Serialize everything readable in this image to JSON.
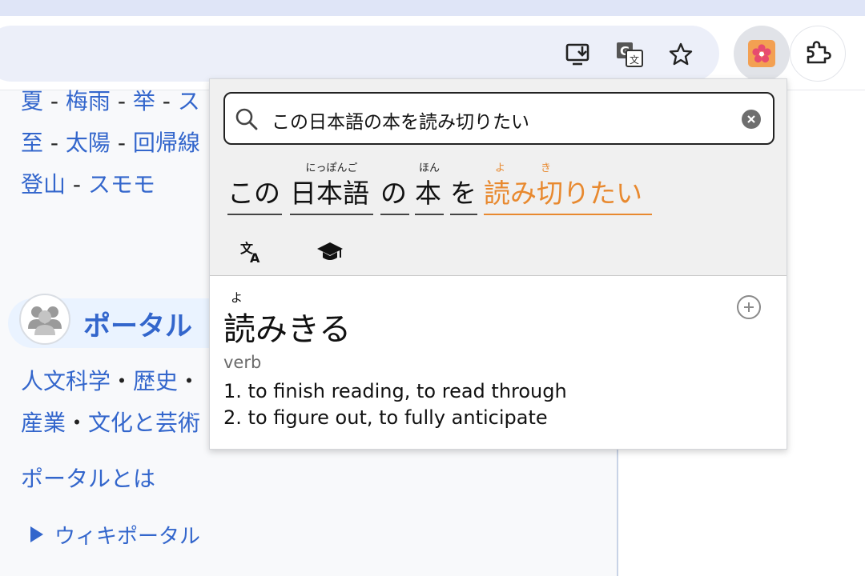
{
  "browser": {
    "toolbar_icons": [
      "install-app-icon",
      "translate-page-icon",
      "bookmark-star-icon"
    ],
    "extension_icon": "sakura-flower-icon",
    "extensions_menu_icon": "puzzle-icon"
  },
  "page": {
    "lines": [
      [
        {
          "text": "夏"
        },
        {
          "sep": " - "
        },
        {
          "text": "梅雨"
        },
        {
          "sep": " - "
        },
        {
          "text": "举"
        },
        {
          "sep": " - "
        },
        {
          "text": "ス"
        }
      ],
      [
        {
          "text": "至"
        },
        {
          "sep": " - "
        },
        {
          "text": "太陽"
        },
        {
          "sep": " - "
        },
        {
          "text": "回帰線"
        }
      ],
      [
        {
          "text": "登山"
        },
        {
          "sep": " - "
        },
        {
          "text": "スモモ"
        }
      ]
    ],
    "portal_title": "ポータル",
    "portal_icon": "users-group-icon",
    "portal_links_1": [
      {
        "text": "人文科学"
      },
      {
        "sep": "・"
      },
      {
        "text": "歴史"
      },
      {
        "sep": "・"
      }
    ],
    "portal_links_2": [
      {
        "text": "産業"
      },
      {
        "sep": "・"
      },
      {
        "text": "文化と芸術"
      }
    ],
    "portal_about": "ポータルとは",
    "wiki_portal": "ウィキポータル"
  },
  "popup": {
    "search_value": "この日本語の本を読み切りたい",
    "segments": [
      {
        "base": "この",
        "reading": ""
      },
      {
        "base": "日本語",
        "reading": "にっぽんご"
      },
      {
        "base": "の",
        "reading": ""
      },
      {
        "base": "本",
        "reading": "ほん"
      },
      {
        "base": "を",
        "reading": ""
      },
      {
        "base": "読み切りたい",
        "reading": "よ　　き",
        "active": true
      }
    ],
    "tabs": [
      "translate-icon",
      "graduation-cap-icon"
    ],
    "entry": {
      "reading": "よ",
      "word": "読みきる",
      "pos": "verb",
      "senses": [
        "1. to finish reading, to read through",
        "2. to figure out, to fully anticipate"
      ]
    },
    "colors": {
      "accent": "#e8892f",
      "link": "#3366cc"
    }
  }
}
